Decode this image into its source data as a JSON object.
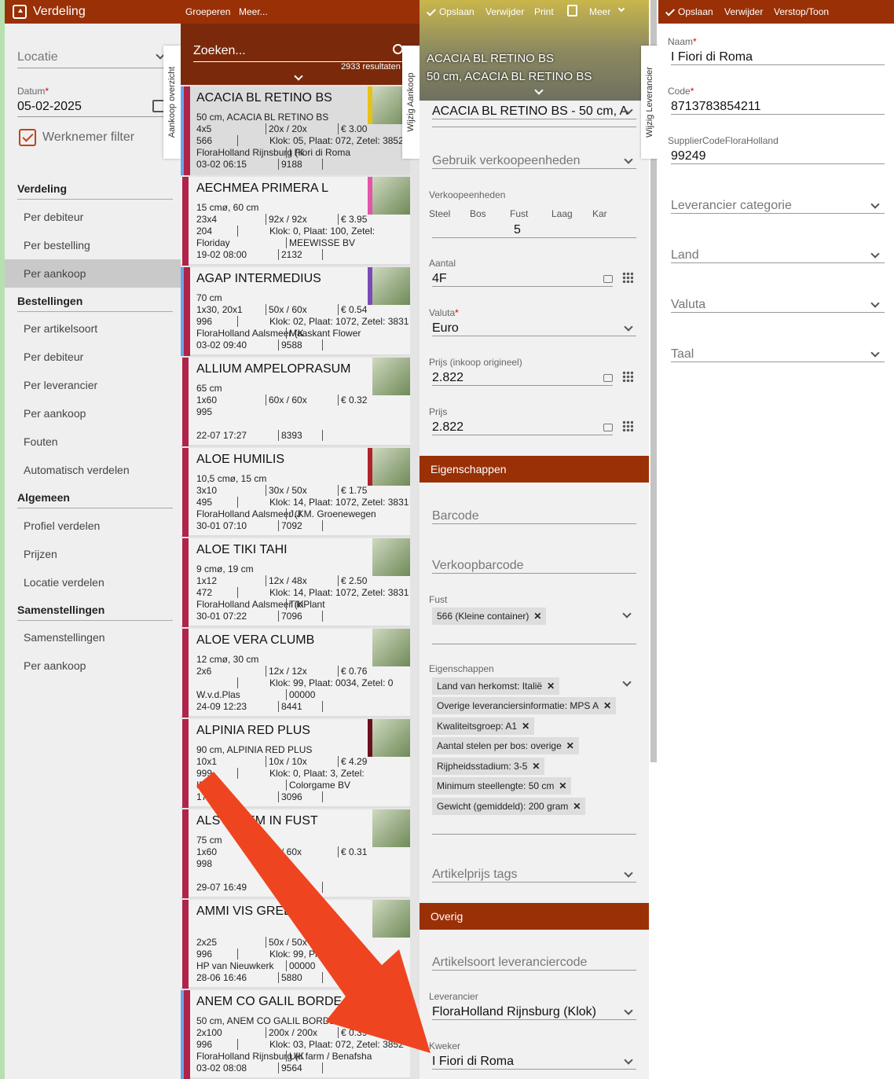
{
  "app": {
    "title": "Verdeling",
    "accent": "#9a3006"
  },
  "sidebar": {
    "locatie_placeholder": "Locatie",
    "datum_label": "Datum",
    "datum_value": "05-02-2025",
    "werknemer_filter": "Werknemer filter",
    "sections": [
      {
        "title": "Verdeling",
        "items": [
          "Per debiteur",
          "Per bestelling",
          "Per aankoop"
        ]
      },
      {
        "title": "Bestellingen",
        "items": [
          "Per artikelsoort",
          "Per debiteur",
          "Per leverancier",
          "Per aankoop",
          "Fouten",
          "Automatisch verdelen"
        ]
      },
      {
        "title": "Algemeen",
        "items": [
          "Profiel verdelen",
          "Prijzen",
          "Locatie verdelen"
        ]
      },
      {
        "title": "Samenstellingen",
        "items": [
          "Samenstellingen",
          "Per aankoop"
        ]
      }
    ],
    "tab_overzicht": "Aankoop overzicht"
  },
  "list": {
    "toolbar": {
      "groeperen": "Groeperen",
      "meer": "Meer..."
    },
    "search_placeholder": "Zoeken...",
    "result_count": "2933 resultaten",
    "tab_wijzig": "Wijzig Aankoop",
    "items": [
      {
        "title": "ACACIA BL RETINO BS",
        "l1": "50 cm, ACACIA BL RETINO BS",
        "a": "4x5",
        "b": "20x / 20x",
        "c": "€ 3.00",
        "d": "566",
        "e": "Klok: 05, Plaat: 072, Zetel: 3852",
        "f": "FloraHolland Rijnsburg (K",
        "g": "I Fiori di Roma",
        "h": "03-02 06:15",
        "i": "9188",
        "stripe": "#e6c219"
      },
      {
        "title": "AECHMEA PRIMERA L",
        "l1": "15 cmø, 60 cm",
        "a": "23x4",
        "b": "92x / 92x",
        "c": "€ 3.95",
        "d": "204",
        "e": "Klok: 0, Plaat: 100, Zetel:",
        "f": "Floriday",
        "g": "MEEWISSE BV",
        "h": "19-02 08:00",
        "i": "2132",
        "stripe": "#e255a8"
      },
      {
        "title": "AGAP INTERMEDIUS",
        "l1": "70 cm",
        "a": "1x30, 20x1",
        "b": "50x / 60x",
        "c": "€ 0.54",
        "d": "996",
        "e": "Klok: 02, Plaat: 1072, Zetel: 3831",
        "f": "FloraHolland Aalsmeer (K",
        "g": "Maaskant Flower",
        "h": "03-02 09:40",
        "i": "9588",
        "stripe": "#7a4bb8"
      },
      {
        "title": "ALLIUM AMPELOPRASUM",
        "l1": "65 cm",
        "a": "1x60",
        "b": "60x / 60x",
        "c": "€ 0.32",
        "d": "995",
        "e": "",
        "f": "",
        "g": "",
        "h": "22-07 17:27",
        "i": "8393",
        "stripe": ""
      },
      {
        "title": "ALOE HUMILIS",
        "l1": "10,5 cmø, 15 cm",
        "a": "3x10",
        "b": "30x / 50x",
        "c": "€ 1.75",
        "d": "495",
        "e": "Klok: 14, Plaat: 1072, Zetel: 3831",
        "f": "FloraHolland Aalsmeer (K",
        "g": "J.J.M. Groenewegen",
        "h": "30-01 07:10",
        "i": "7092",
        "stripe": "#b0232a"
      },
      {
        "title": "ALOE TIKI TAHI",
        "l1": "9 cmø, 19 cm",
        "a": "1x12",
        "b": "12x / 48x",
        "c": "€ 2.50",
        "d": "472",
        "e": "Klok: 14, Plaat: 1072, Zetel: 3831",
        "f": "FloraHolland Aalsmeer (K",
        "g": "TikiPlant",
        "h": "30-01 07:22",
        "i": "7096",
        "stripe": ""
      },
      {
        "title": "ALOE VERA CLUMB",
        "l1": "12 cmø, 30 cm",
        "a": "2x6",
        "b": "12x / 12x",
        "c": "€ 0.76",
        "d": "",
        "e": "Klok: 99, Plaat: 0034, Zetel: 0",
        "f": "W.v.d.Plas",
        "g": "00000",
        "h": "24-09 12:23",
        "i": "8441",
        "stripe": ""
      },
      {
        "title": "ALPINIA RED PLUS",
        "l1": "90 cm, ALPINIA RED PLUS",
        "a": "10x1",
        "b": "10x / 10x",
        "c": "€ 4.29",
        "d": "999",
        "e": "Klok: 0, Plaat: 3, Zetel:",
        "f": "IMEX",
        "g": "Colorgame BV",
        "h": "17:53",
        "i": "3096",
        "stripe": "#6a1020"
      },
      {
        "title": "ALSTROEM IN FUST",
        "l1": "75 cm",
        "a": "1x60",
        "b": "0x / 60x",
        "c": "€ 0.31",
        "d": "998",
        "e": "",
        "f": "",
        "g": "",
        "h": "29-07 16:49",
        "i": "",
        "stripe": ""
      },
      {
        "title": "AMMI VIS GREEN",
        "l1": "",
        "a": "2x25",
        "b": "50x / 50x",
        "c": "34",
        "d": "996",
        "e": "Klok: 99, Plaat",
        "f": "HP van Nieuwkerk",
        "g": "00000",
        "h": "28-06 16:46",
        "i": "5880",
        "stripe": ""
      },
      {
        "title": "ANEM CO GALIL BORDEA",
        "l1": "50 cm, ANEM CO GALIL BORDEA",
        "a": "2x100",
        "b": "200x / 200x",
        "c": "€ 0.39",
        "d": "996",
        "e": "Klok: 03, Plaat: 072, Zetel: 3852",
        "f": "FloraHolland Rijnsburg (K",
        "g": "Uki farm / Benafsha",
        "h": "03-02 08:08",
        "i": "9564",
        "stripe": ""
      }
    ]
  },
  "detail": {
    "toolbar": {
      "opslaan": "Opslaan",
      "verwijder": "Verwijder",
      "print": "Print",
      "meer": "Meer"
    },
    "header_line1": "ACACIA BL RETINO BS",
    "header_line2": "50 cm, ACACIA BL RETINO BS",
    "article_select": "ACACIA BL RETINO BS - 50 cm, A",
    "gebruik": "Gebruik verkoopeenheden",
    "verkoopeenheden_label": "Verkoopeenheden",
    "units": [
      "Steel",
      "Bos",
      "Fust",
      "Laag",
      "Kar"
    ],
    "fust_value": "5",
    "aantal_label": "Aantal",
    "aantal": "4F",
    "valuta_label": "Valuta",
    "valuta": "Euro",
    "prijs_orig_label": "Prijs (inkoop origineel)",
    "prijs_orig": "2.822",
    "prijs_label": "Prijs",
    "prijs": "2.822",
    "eigenschappen_section": "Eigenschappen",
    "barcode": "Barcode",
    "verkoopbarcode": "Verkoopbarcode",
    "fust_label": "Fust",
    "fust_chip": "566 (Kleine container)",
    "eig_label": "Eigenschappen",
    "eig_chips": [
      "Land van herkomst: Italië",
      "Overige leveranciersinformatie: MPS A",
      "Kwaliteitsgroep: A1",
      "Aantal stelen per bos: overige",
      "Rijpheidsstadium: 3-5",
      "Minimum steellengte: 50 cm",
      "Gewicht (gemiddeld): 200 gram"
    ],
    "artikelprijs": "Artikelprijs tags",
    "overig_section": "Overig",
    "artikelsoort_code": "Artikelsoort leveranciercode",
    "leverancier_label": "Leverancier",
    "leverancier": "FloraHolland Rijnsburg (Klok)",
    "kweker_label": "Kweker",
    "kweker": "I Fiori di Roma",
    "tab_wijzig": "Wijzig Leverancier"
  },
  "supplier": {
    "toolbar": {
      "opslaan": "Opslaan",
      "verwijder": "Verwijder",
      "verstop": "Verstop/Toon"
    },
    "naam_label": "Naam",
    "naam": "I Fiori di Roma",
    "code_label": "Code",
    "code": "8713783854211",
    "scf_label": "SupplierCodeFloraHolland",
    "scf": "99249",
    "categorie": "Leverancier categorie",
    "land": "Land",
    "valuta": "Valuta",
    "taal": "Taal"
  }
}
